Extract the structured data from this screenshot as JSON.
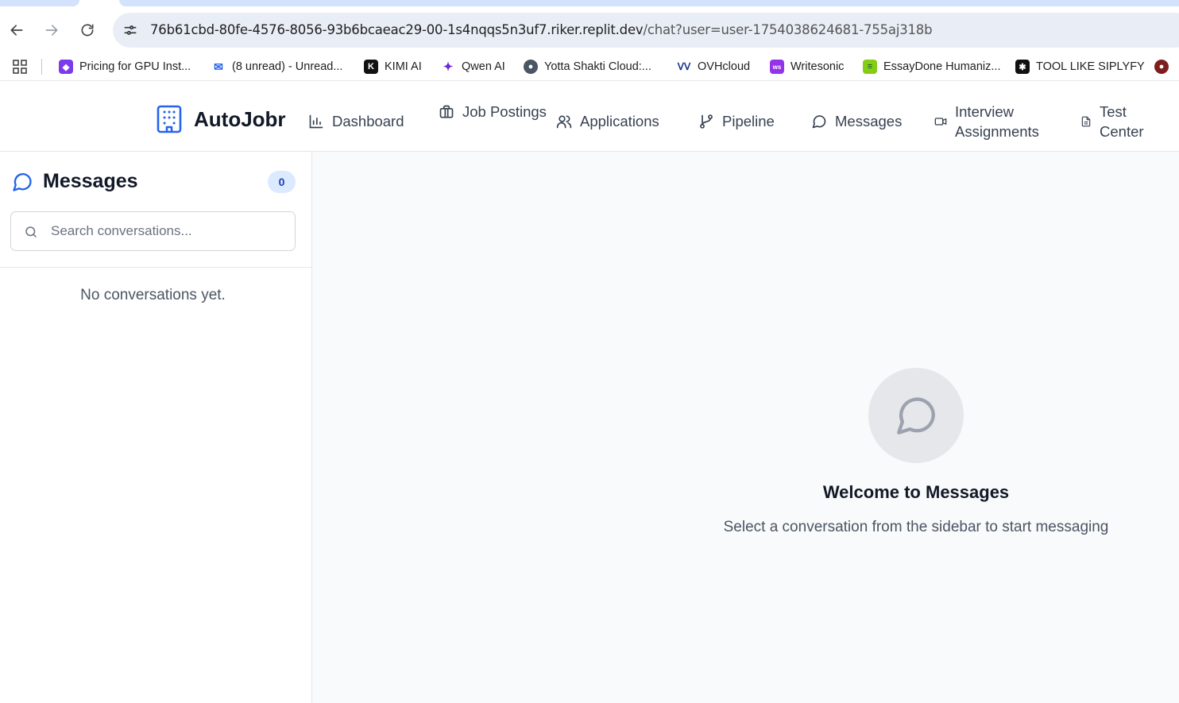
{
  "browser": {
    "url_host": "76b61cbd-80fe-4576-8056-93b6bcaeac29-00-1s4nqqs5n3uf7.riker.replit.dev",
    "url_path": "/chat?user=user-1754038624681-755aj318b",
    "bookmarks": [
      {
        "label": "Pricing for GPU Inst...",
        "icon": "cube-icon",
        "color": "#7c3aed"
      },
      {
        "label": "(8 unread) - Unread...",
        "icon": "mail-icon",
        "color": "#2563eb"
      },
      {
        "label": "KIMI AI",
        "icon": "kimi-icon",
        "color": "#111111"
      },
      {
        "label": "Qwen AI",
        "icon": "qwen-icon",
        "color": "#6d28d9"
      },
      {
        "label": "Yotta Shakti Cloud:...",
        "icon": "globe-icon",
        "color": "#4b5563"
      },
      {
        "label": "OVHcloud",
        "icon": "ovh-icon",
        "color": "#1e3a8a"
      },
      {
        "label": "Writesonic",
        "icon": "writesonic-icon",
        "color": "#9333ea"
      },
      {
        "label": "EssayDone Humaniz...",
        "icon": "essaydone-icon",
        "color": "#65a30d"
      },
      {
        "label": "TOOL LIKE SIPLYFY",
        "icon": "tool-icon",
        "color": "#111111"
      }
    ]
  },
  "app": {
    "brand": "AutoJobr",
    "accent": "#2563eb",
    "nav": [
      {
        "label": "Dashboard",
        "icon": "bar-chart-icon"
      },
      {
        "label": "Job Postings",
        "icon": "briefcase-icon"
      },
      {
        "label": "Applications",
        "icon": "users-icon"
      },
      {
        "label": "Pipeline",
        "icon": "git-branch-icon"
      },
      {
        "label": "Messages",
        "icon": "message-circle-icon"
      },
      {
        "label": "Interview Assignments",
        "icon": "video-icon"
      },
      {
        "label": "Test Center",
        "icon": "file-text-icon"
      }
    ]
  },
  "sidebar": {
    "title": "Messages",
    "count": "0",
    "search_placeholder": "Search conversations...",
    "empty_text": "No conversations yet."
  },
  "main": {
    "welcome_title": "Welcome to Messages",
    "welcome_subtitle": "Select a conversation from the sidebar to start messaging"
  }
}
